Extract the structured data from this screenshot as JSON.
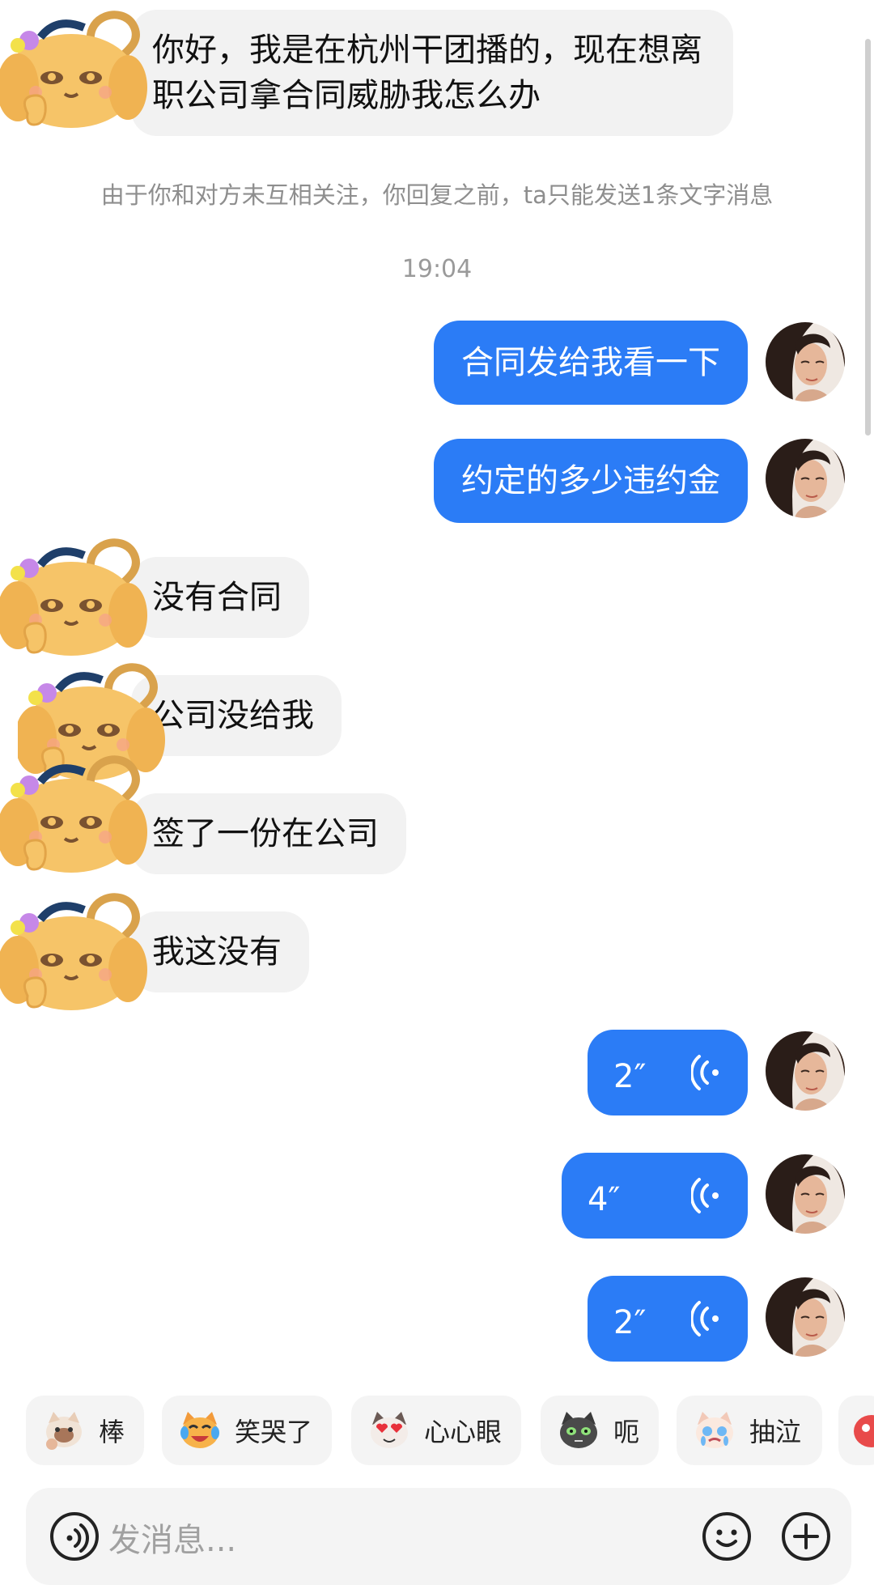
{
  "notice": "由于你和对方未互相关注，你回复之前，ta只能发送1条文字消息",
  "timestamp": "19:04",
  "messages_in": [
    {
      "text": "你好，我是在杭州干团播的，现在想离职公司拿合同威胁我怎么办"
    },
    {
      "text": "没有合同"
    },
    {
      "text": "公司没给我"
    },
    {
      "text": "签了一份在公司"
    },
    {
      "text": "我这没有"
    }
  ],
  "messages_out": [
    {
      "text": "合同发给我看一下"
    },
    {
      "text": "约定的多少违约金"
    }
  ],
  "voice_messages": [
    {
      "duration": "2″"
    },
    {
      "duration": "4″"
    },
    {
      "duration": "2″"
    }
  ],
  "quick_replies": [
    {
      "label": "棒",
      "icon": "cat-thumbs-up-emoji"
    },
    {
      "label": "笑哭了",
      "icon": "cat-laugh-cry-emoji"
    },
    {
      "label": "心心眼",
      "icon": "cat-heart-eyes-emoji"
    },
    {
      "label": "呃",
      "icon": "cat-speechless-emoji"
    },
    {
      "label": "抽泣",
      "icon": "cat-sob-emoji"
    }
  ],
  "input": {
    "placeholder": "发消息..."
  },
  "colors": {
    "outgoing": "#2b7cf6",
    "incoming": "#f2f2f2",
    "background": "#ffffff"
  }
}
